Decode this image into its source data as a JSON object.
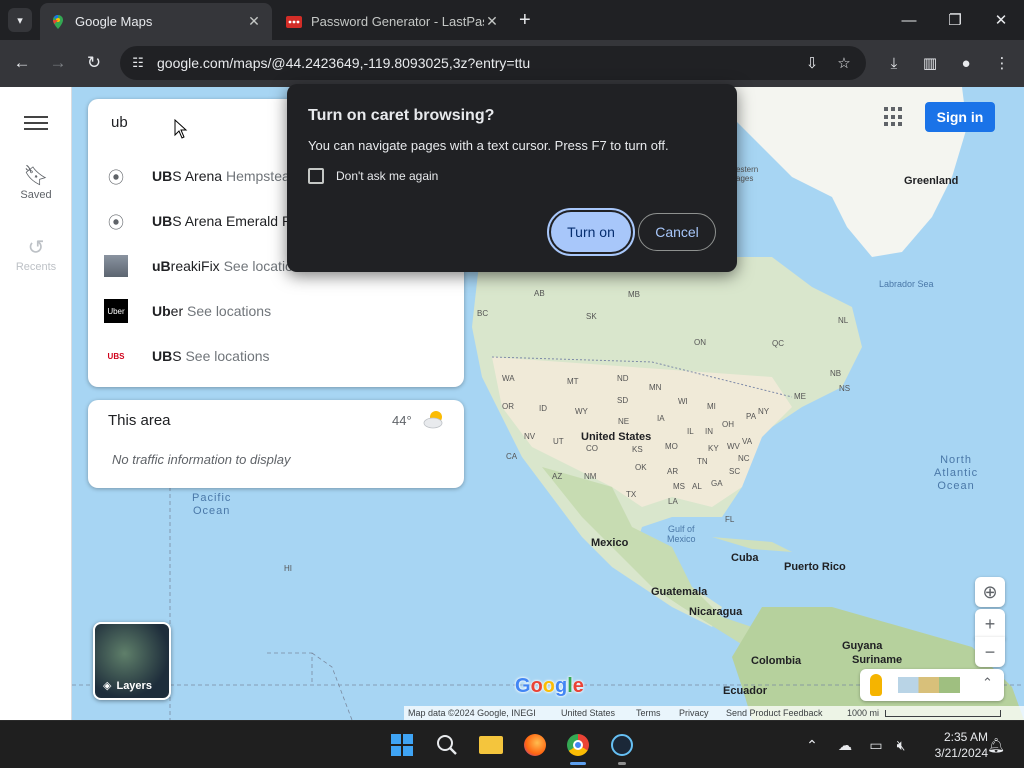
{
  "browser": {
    "tabs": [
      {
        "title": "Google Maps",
        "active": true
      },
      {
        "title": "Password Generator - LastPass",
        "active": false
      }
    ],
    "url": "google.com/maps/@44.2423649,-119.8093025,3z?entry=ttu"
  },
  "icons": {
    "tab_search": "chevron-down",
    "back": "arrow-left",
    "forward": "arrow-right",
    "reload": "reload",
    "site_info": "tune",
    "install": "install-app",
    "bookmark": "star",
    "downloads": "download",
    "side_panel": "side-panel",
    "profile": "person",
    "menu": "kebab-menu"
  },
  "sidebar": {
    "saved_label": "Saved",
    "recents_label": "Recents"
  },
  "search": {
    "query": "ub",
    "suggestions": [
      {
        "bold": "UB",
        "rest": "S Arena",
        "sub": "Hempstead",
        "icon": "pin"
      },
      {
        "bold": "UB",
        "rest": "S Arena Emerald Pa",
        "sub": "",
        "icon": "pin"
      },
      {
        "bold": "uB",
        "rest": "reakiFix",
        "sub": "See location",
        "icon": "thumb"
      },
      {
        "bold": "Ub",
        "rest": "er",
        "sub": "See locations",
        "icon": "uber"
      },
      {
        "bold": "UB",
        "rest": "S",
        "sub": "See locations",
        "icon": "ubs"
      }
    ],
    "uber_logo_text": "Uber",
    "ubs_logo_text": "UBS"
  },
  "area": {
    "title": "This area",
    "temp": "44°",
    "message": "No traffic information to display"
  },
  "dialog": {
    "title": "Turn on caret browsing?",
    "message": "You can navigate pages with a text cursor. Press F7 to turn off.",
    "checkbox_label": "Don't ask me again",
    "primary": "Turn on",
    "secondary": "Cancel"
  },
  "map": {
    "signin": "Sign in",
    "layers": "Layers",
    "logo": "Google",
    "labels": {
      "greenland": "Greenland",
      "labrador": "Labrador Sea",
      "us": "United States",
      "mexico": "Mexico",
      "cuba": "Cuba",
      "pr": "Puerto Rico",
      "guatemala": "Guatemala",
      "nicaragua": "Nicaragua",
      "colombia": "Colombia",
      "guyana": "Guyana",
      "suriname": "Suriname",
      "ecuador": "Ecuador",
      "gulf": "Gulf of\nMexico",
      "north_pacific": "North\nPacific\nOcean",
      "north_atlantic": "North\nAtlantic\nOcean",
      "western_ages": "estern\nages",
      "hi": "HI",
      "ab": "AB",
      "bc": "BC",
      "sk": "SK",
      "mb": "MB",
      "on": "ON",
      "qc": "QC",
      "nl": "NL",
      "wa": "WA",
      "mt": "MT",
      "nd": "ND",
      "or": "OR",
      "id": "ID",
      "wy": "WY",
      "sd": "SD",
      "mn": "MN",
      "wi": "WI",
      "mi": "MI",
      "ny": "NY",
      "me": "ME",
      "ne": "NE",
      "ia": "IA",
      "nv": "NV",
      "ut": "UT",
      "co": "CO",
      "ks": "KS",
      "mo": "MO",
      "il": "IL",
      "in": "IN",
      "oh": "OH",
      "pa": "PA",
      "ca": "CA",
      "az": "AZ",
      "nm": "NM",
      "ok": "OK",
      "ar": "AR",
      "tn": "TN",
      "ky": "KY",
      "wv": "WV",
      "va": "VA",
      "nc": "NC",
      "sc": "SC",
      "ga": "GA",
      "al": "AL",
      "ms": "MS",
      "la": "LA",
      "tx": "TX",
      "fl": "FL",
      "ns": "NS",
      "nb": "NB"
    },
    "attribution": {
      "data": "Map data ©2024 Google, INEGI",
      "country": "United States",
      "terms": "Terms",
      "privacy": "Privacy",
      "feedback": "Send Product Feedback",
      "scale": "1000 mi"
    }
  },
  "taskbar": {
    "time": "2:35 AM",
    "date": "3/21/2024"
  }
}
